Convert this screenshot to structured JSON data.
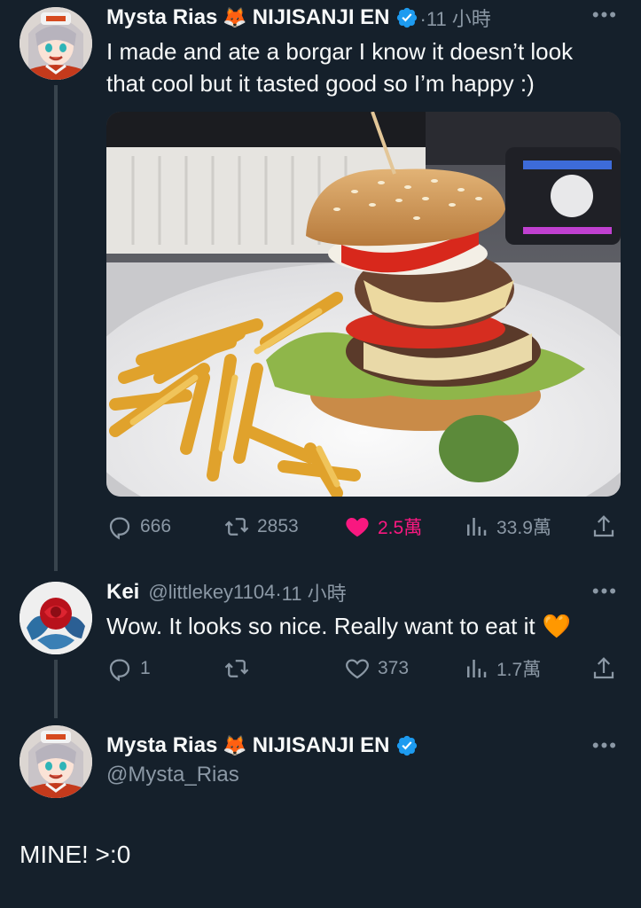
{
  "tweet1": {
    "display_name": "Mysta Rias",
    "org": "NIJISANJI EN",
    "emoji": "🦊",
    "time": "·11 小時",
    "text_line1": "I made and ate a borgar I know it doesn’t look",
    "text_line2": "that cool but it tasted good so I’m happy :)",
    "replies": "666",
    "retweets": "2853",
    "likes": "2.5萬",
    "views": "33.9萬",
    "liked": true
  },
  "reply": {
    "display_name": "Kei",
    "handle": "@littlekey1104",
    "time": "·11 小時",
    "text": "Wow. It looks so nice. Really want to eat it",
    "emoji": "🧡",
    "replies": "1",
    "retweets": "",
    "likes": "373",
    "views": "1.7萬"
  },
  "compose": {
    "display_name": "Mysta Rias",
    "org": "NIJISANJI EN",
    "emoji": "🦊",
    "handle": "@Mysta_Rias",
    "text": "MINE! >:0"
  },
  "colors": {
    "background": "#15202b",
    "muted": "#8b98a5",
    "verified": "#1d9bf0",
    "like": "#f91880",
    "line": "#38444d"
  },
  "icons": [
    "reply-icon",
    "retweet-icon",
    "heart-icon",
    "views-icon",
    "share-icon",
    "verified-icon",
    "more-icon"
  ]
}
